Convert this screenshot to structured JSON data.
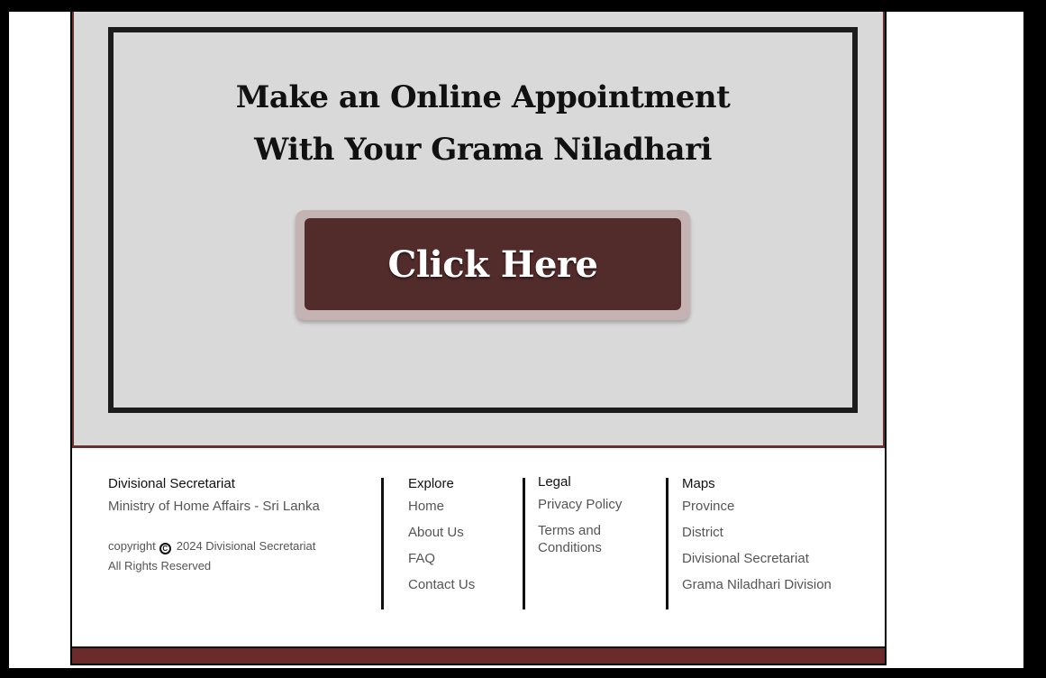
{
  "hero": {
    "title_line1": "Make an Online Appointment",
    "title_line2": "With Your Grama Niladhari",
    "cta_label": "Click Here"
  },
  "footer": {
    "org": {
      "name": "Divisional Secretariat",
      "ministry": "Ministry of Home Affairs - Sri Lanka",
      "copyright_prefix": "copyright",
      "copyright_text": "2024 Divisional Secretariat",
      "rights": "All Rights Reserved"
    },
    "explore": {
      "title": "Explore",
      "links": [
        "Home",
        "About Us",
        "FAQ",
        "Contact Us"
      ]
    },
    "legal": {
      "title": "Legal",
      "links": [
        "Privacy Policy",
        "Terms and Conditions"
      ]
    },
    "maps": {
      "title": "Maps",
      "links": [
        "Province",
        "District",
        "Divisional Secretariat",
        "Grama Niladhari Division"
      ]
    }
  },
  "colors": {
    "hero_bg": "#d9d9d9",
    "cta_bg": "#522b2b",
    "cta_border": "#c4b3b2",
    "accent": "#6b2b2b"
  }
}
